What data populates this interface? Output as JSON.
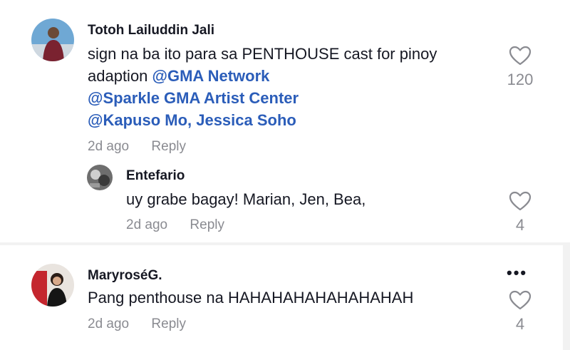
{
  "comments": [
    {
      "author": "Totoh Lailuddin Jali",
      "text_line1": "sign na ba ito para sa PENTHOUSE cast for pinoy",
      "text_line2_prefix": "adaption ",
      "mentions": [
        "@GMA Network",
        "@Sparkle GMA Artist Center",
        "@Kapuso Mo, Jessica Soho"
      ],
      "time": "2d ago",
      "reply_label": "Reply",
      "likes": "120",
      "reply": {
        "author": "Entefario",
        "text": "uy grabe bagay! Marian, Jen, Bea,",
        "time": "2d ago",
        "reply_label": "Reply",
        "likes": "4"
      }
    },
    {
      "author": "MaryroséG.",
      "text": "Pang penthouse na HAHAHAHAHAHAHAHAH",
      "time": "2d ago",
      "reply_label": "Reply",
      "likes": "4",
      "more_label": "•••"
    }
  ],
  "icons": {
    "like": "heart-outline-icon",
    "more": "more-options-icon"
  },
  "colors": {
    "mention": "#2b5db9",
    "muted": "#8a8b91",
    "text": "#161823"
  }
}
